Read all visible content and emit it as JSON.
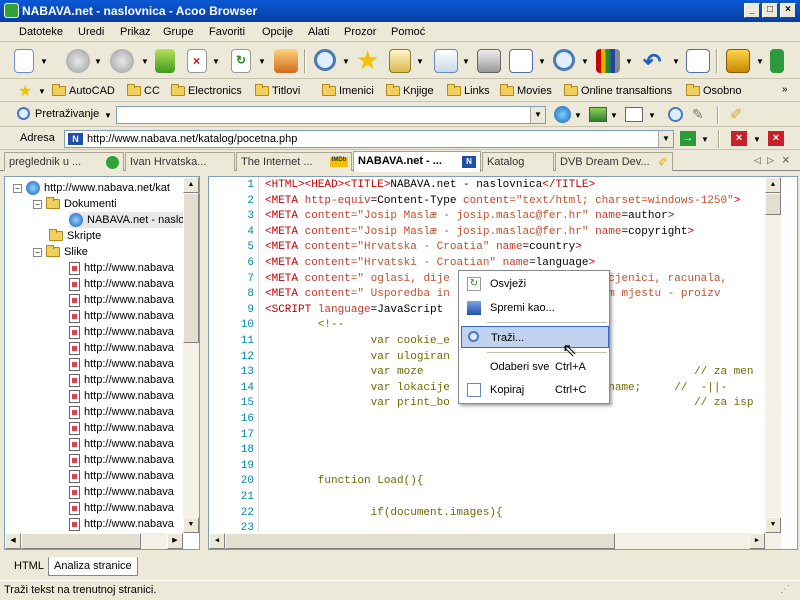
{
  "window": {
    "title": "NABAVA.net - naslovnica - Acoo Browser",
    "min": "_",
    "max": "□",
    "close": "×"
  },
  "menu": [
    "Datoteke",
    "Uredi",
    "Prikaz",
    "Grupe",
    "Favoriti",
    "Opcije",
    "Alati",
    "Prozor",
    "Pomoć"
  ],
  "bookmarks": [
    "AutoCAD",
    "CC",
    "Electronics",
    "Titlovi",
    "Imenici",
    "Knjige",
    "Links",
    "Movies",
    "Online transaltions",
    "Osobno"
  ],
  "search": {
    "label": "Pretraživanje",
    "value": ""
  },
  "address": {
    "label": "Adresa",
    "value": "http://www.nabava.net/katalog/pocetna.php"
  },
  "tabs": [
    "preglednik u ...",
    "Ivan Hrvatska...",
    "The Internet ...",
    "NABAVA.net - ...",
    "Katalog",
    "DVB Dream Dev..."
  ],
  "tree": {
    "root": "http://www.nabava.net/kat",
    "dokumenti": "Dokumenti",
    "doc_item": "NABAVA.net - naslo",
    "skripte": "Skripte",
    "slike": "Slike",
    "images": [
      "http://www.nabava",
      "http://www.nabava",
      "http://www.nabava",
      "http://www.nabava",
      "http://www.nabava",
      "http://www.nabava",
      "http://www.nabava",
      "http://www.nabava",
      "http://www.nabava",
      "http://www.nabava",
      "http://www.nabava",
      "http://www.nabava",
      "http://www.nabava",
      "http://www.nabava",
      "http://www.nabava",
      "http://www.nabava",
      "http://www.nabava"
    ]
  },
  "code_lines": [
    {
      "n": "1",
      "parts": [
        [
          "tag",
          "<HTML><HEAD><TITLE>"
        ],
        [
          "pl",
          "NABAVA.net - naslovnica"
        ],
        [
          "tag",
          "</TITLE>"
        ]
      ]
    },
    {
      "n": "2",
      "parts": [
        [
          "tag",
          "<META "
        ],
        [
          "att",
          "http-equiv"
        ],
        [
          "pl",
          "=Content-Type "
        ],
        [
          "att",
          "content"
        ],
        [
          "str",
          "=\"text/html; charset=windows-1250\""
        ],
        [
          "tag",
          ">"
        ]
      ]
    },
    {
      "n": "3",
      "parts": [
        [
          "tag",
          "<META "
        ],
        [
          "att",
          "content"
        ],
        [
          "str",
          "=\"Josip Maslæ - josip.maslac@fer.hr\" "
        ],
        [
          "att",
          "name"
        ],
        [
          "pl",
          "=author"
        ],
        [
          "tag",
          ">"
        ]
      ]
    },
    {
      "n": "4",
      "parts": [
        [
          "tag",
          "<META "
        ],
        [
          "att",
          "content"
        ],
        [
          "str",
          "=\"Josip Maslæ - josip.maslac@fer.hr\" "
        ],
        [
          "att",
          "name"
        ],
        [
          "pl",
          "=copyright"
        ],
        [
          "tag",
          ">"
        ]
      ]
    },
    {
      "n": "5",
      "parts": [
        [
          "tag",
          "<META "
        ],
        [
          "att",
          "content"
        ],
        [
          "str",
          "=\"Hrvatska - Croatia\" "
        ],
        [
          "att",
          "name"
        ],
        [
          "pl",
          "=country"
        ],
        [
          "tag",
          ">"
        ]
      ]
    },
    {
      "n": "6",
      "parts": [
        [
          "tag",
          "<META "
        ],
        [
          "att",
          "content"
        ],
        [
          "str",
          "=\"Hrvatski - Croatian\" "
        ],
        [
          "att",
          "name"
        ],
        [
          "pl",
          "=language"
        ],
        [
          "tag",
          ">"
        ]
      ]
    },
    {
      "n": "7",
      "parts": [
        [
          "tag",
          "<META "
        ],
        [
          "att",
          "content"
        ],
        [
          "str",
          "=\" oglasi, dije                   nik, cjenici, racunala, "
        ]
      ]
    },
    {
      "n": "8",
      "parts": [
        [
          "tag",
          "<META "
        ],
        [
          "att",
          "content"
        ],
        [
          "str",
          "=\" Usporedba in                   jednom mjestu - proizv"
        ]
      ]
    },
    {
      "n": "9",
      "parts": [
        [
          "tag",
          "<SCRIPT "
        ],
        [
          "att",
          "language"
        ],
        [
          "pl",
          "=JavaScript"
        ]
      ]
    },
    {
      "n": "10",
      "parts": [
        [
          "kw",
          "        <!--"
        ]
      ]
    },
    {
      "n": "11",
      "parts": [
        [
          "kw",
          "                var cookie_e"
        ]
      ]
    },
    {
      "n": "12",
      "parts": [
        [
          "kw",
          "                var ulogiran"
        ]
      ]
    },
    {
      "n": "13",
      "parts": [
        [
          "kw",
          "                var moze                                         // za men"
        ]
      ]
    },
    {
      "n": "14",
      "parts": [
        [
          "kw",
          "                var lokacije                  n.pathname;     //  -||-"
        ]
      ]
    },
    {
      "n": "15",
      "parts": [
        [
          "kw",
          "                var print_bo                                     // za isp"
        ]
      ]
    },
    {
      "n": "16",
      "parts": [
        [
          "kw",
          ""
        ]
      ]
    },
    {
      "n": "17",
      "parts": [
        [
          "kw",
          ""
        ]
      ]
    },
    {
      "n": "18",
      "parts": [
        [
          "kw",
          ""
        ]
      ]
    },
    {
      "n": "19",
      "parts": [
        [
          "kw",
          ""
        ]
      ]
    },
    {
      "n": "20",
      "parts": [
        [
          "kw",
          "        function Load(){"
        ]
      ]
    },
    {
      "n": "21",
      "parts": [
        [
          "kw",
          ""
        ]
      ]
    },
    {
      "n": "22",
      "parts": [
        [
          "kw",
          "                if(document.images){"
        ]
      ]
    },
    {
      "n": "23",
      "parts": [
        [
          "kw",
          ""
        ]
      ]
    }
  ],
  "context_menu": {
    "refresh": "Osvježi",
    "save_as": "Spremi kao...",
    "find": "Traži...",
    "select_all": "Odaberi sve",
    "select_all_key": "Ctrl+A",
    "copy": "Kopiraj",
    "copy_key": "Ctrl+C"
  },
  "bottom_tabs": [
    "HTML",
    "Analiza stranice"
  ],
  "status": "Traži tekst na trenutnoj stranici."
}
